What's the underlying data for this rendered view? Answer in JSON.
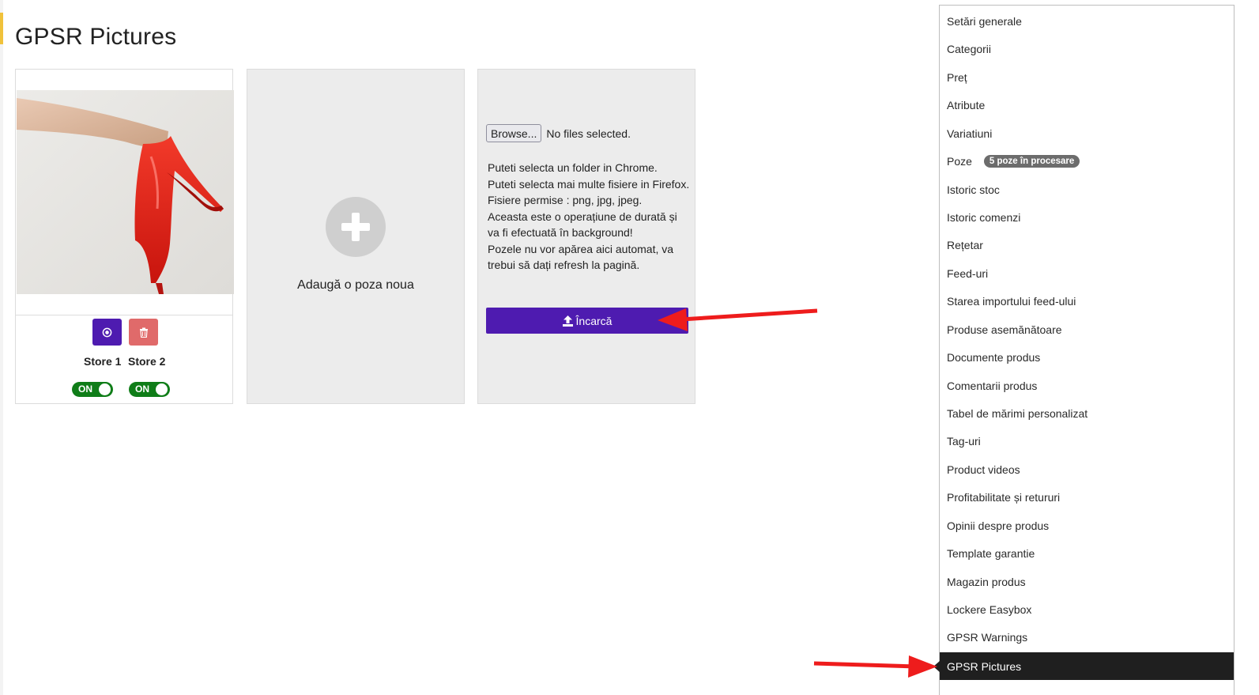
{
  "page": {
    "title": "GPSR Pictures"
  },
  "image_card": {
    "image_alt": "red high heel shoe",
    "default_button_icon": "circle-dot-icon",
    "delete_button_icon": "trash-icon",
    "stores": [
      {
        "label": "Store 1",
        "toggle_label": "ON"
      },
      {
        "label": "Store 2",
        "toggle_label": "ON"
      }
    ]
  },
  "add_card": {
    "label": "Adaugă o poza noua",
    "icon": "plus-icon"
  },
  "upload_card": {
    "browse_label": "Browse...",
    "no_files_label": "No files selected.",
    "info_lines": [
      "Puteti selecta un folder in Chrome.",
      "Puteti selecta mai multe fisiere in Firefox.",
      "Fisiere permise : png, jpg, jpeg.",
      "Aceasta este o operațiune de durată și va fi efectuată în background!",
      "Pozele nu vor apărea aici automat, va trebui să dați refresh la pagină."
    ],
    "upload_label": "Încarcă",
    "upload_icon": "upload-icon"
  },
  "menu": {
    "items": [
      {
        "label": "Setări generale"
      },
      {
        "label": "Categorii"
      },
      {
        "label": "Preț"
      },
      {
        "label": "Atribute"
      },
      {
        "label": "Variatiuni"
      },
      {
        "label": "Poze",
        "badge": "5 poze în procesare"
      },
      {
        "label": "Istoric stoc"
      },
      {
        "label": "Istoric comenzi"
      },
      {
        "label": "Rețetar"
      },
      {
        "label": "Feed-uri"
      },
      {
        "label": "Starea importului feed-ului"
      },
      {
        "label": "Produse asemănătoare"
      },
      {
        "label": "Documente produs"
      },
      {
        "label": "Comentarii produs"
      },
      {
        "label": "Tabel de mărimi personalizat"
      },
      {
        "label": "Tag-uri"
      },
      {
        "label": "Product videos"
      },
      {
        "label": "Profitabilitate și retururi"
      },
      {
        "label": "Opinii despre produs"
      },
      {
        "label": "Template garantie"
      },
      {
        "label": "Magazin produs"
      },
      {
        "label": "Lockere Easybox"
      },
      {
        "label": "GPSR Warnings"
      },
      {
        "label": "GPSR Pictures",
        "active": true
      }
    ]
  },
  "colors": {
    "primary": "#4e1bb0",
    "danger": "#e06a6a",
    "toggle_on": "#0f7d18",
    "menu_active_bg": "#1f1f1f",
    "annotation_arrow": "#ee1c1c",
    "badge_bg": "#6c6c6c"
  }
}
